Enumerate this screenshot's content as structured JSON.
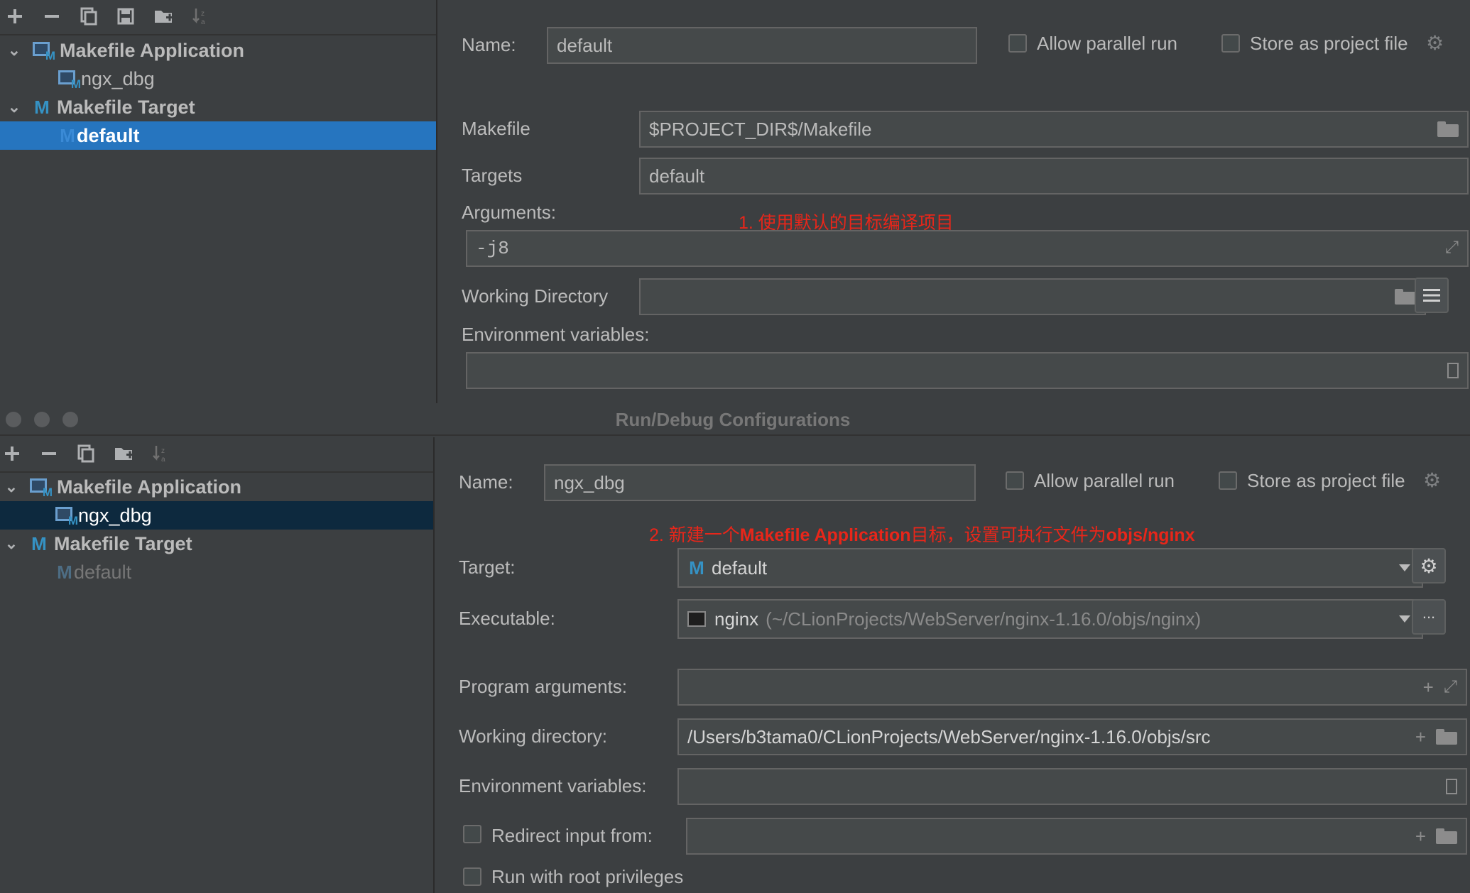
{
  "top": {
    "toolbar": {
      "add": "+",
      "remove": "−",
      "copy": "copy",
      "save": "save",
      "folder": "folder",
      "sort": "sort"
    },
    "tree": {
      "group1": "Makefile Application",
      "group1_child": "ngx_dbg",
      "group2": "Makefile Target",
      "group2_child": "default"
    },
    "form": {
      "name_label": "Name:",
      "name_value": "default",
      "allow_parallel": "Allow parallel run",
      "store_project": "Store as project file",
      "makefile_label": "Makefile",
      "makefile_value": "$PROJECT_DIR$/Makefile",
      "targets_label": "Targets",
      "targets_value": "default",
      "arguments_label": "Arguments:",
      "arguments_value": "-j8",
      "annotation": "1. 使用默认的目标编译项目",
      "workdir_label": "Working Directory",
      "env_label": "Environment variables:"
    }
  },
  "window": {
    "title": "Run/Debug Configurations"
  },
  "bottom": {
    "tree": {
      "group1": "Makefile Application",
      "group1_child": "ngx_dbg",
      "group2": "Makefile Target",
      "group2_child": "default"
    },
    "form": {
      "name_label": "Name:",
      "name_value": "ngx_dbg",
      "allow_parallel": "Allow parallel run",
      "store_project": "Store as project file",
      "annotation_prefix": "2. 新建一个",
      "annotation_b1": "Makefile Application",
      "annotation_mid": "目标，设置可执行文件为",
      "annotation_b2": "objs/nginx",
      "target_label": "Target:",
      "target_value": "default",
      "executable_label": "Executable:",
      "executable_name": "nginx",
      "executable_path": "(~/CLionProjects/WebServer/nginx-1.16.0/objs/nginx)",
      "executable_more": "...",
      "program_args_label": "Program arguments:",
      "workdir_label": "Working directory:",
      "workdir_value": "/Users/b3tama0/CLionProjects/WebServer/nginx-1.16.0/objs/src",
      "env_label": "Environment variables:",
      "redirect_label": "Redirect input from:",
      "root_label": "Run with root privileges"
    }
  },
  "colors": {
    "background": "#3c3f41",
    "selection": "#2675bf",
    "selection_inactive": "#0d293e",
    "annotation": "#e8261a",
    "makefile_icon": "#3592c4"
  }
}
